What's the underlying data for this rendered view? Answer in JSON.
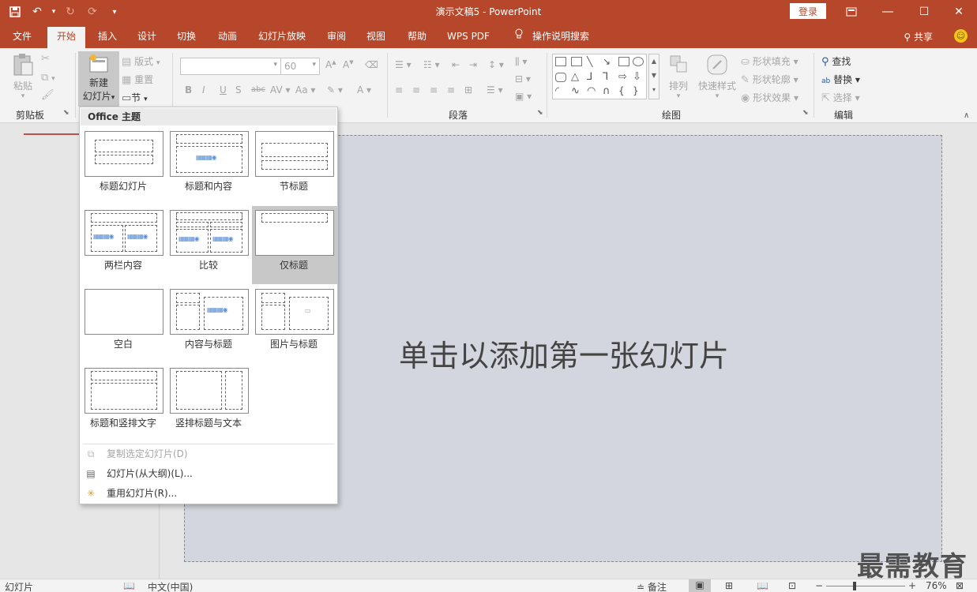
{
  "titlebar": {
    "title": "演示文稿5  -  PowerPoint",
    "login": "登录",
    "qat": [
      "save-icon",
      "undo-icon",
      "redo-icon",
      "repeat-icon",
      "customize-icon"
    ]
  },
  "tabs": [
    {
      "label": "文件"
    },
    {
      "label": "开始"
    },
    {
      "label": "插入"
    },
    {
      "label": "设计"
    },
    {
      "label": "切换"
    },
    {
      "label": "动画"
    },
    {
      "label": "幻灯片放映"
    },
    {
      "label": "审阅"
    },
    {
      "label": "视图"
    },
    {
      "label": "帮助"
    },
    {
      "label": "WPS PDF"
    },
    {
      "label": "操作说明搜索"
    }
  ],
  "share": "共享",
  "ribbon": {
    "clipboard": {
      "label": "剪贴板",
      "paste": "粘贴"
    },
    "slides": {
      "new_slide_line1": "新建",
      "new_slide_line2": "幻灯片",
      "layout": "版式",
      "reset": "重置",
      "section": "节"
    },
    "font": {
      "size": "60"
    },
    "paragraph": {
      "label": "段落"
    },
    "drawing": {
      "label": "绘图",
      "arrange": "排列",
      "quick_styles": "快速样式",
      "shape_fill": "形状填充",
      "shape_outline": "形状轮廓",
      "shape_effect": "形状效果"
    },
    "editing": {
      "label": "编辑",
      "find": "查找",
      "replace": "替换",
      "select": "选择"
    }
  },
  "dropdown": {
    "header": "Office 主题",
    "layouts": [
      {
        "label": "标题幻灯片"
      },
      {
        "label": "标题和内容"
      },
      {
        "label": "节标题"
      },
      {
        "label": "两栏内容"
      },
      {
        "label": "比较"
      },
      {
        "label": "仅标题"
      },
      {
        "label": "空白"
      },
      {
        "label": "内容与标题"
      },
      {
        "label": "图片与标题"
      },
      {
        "label": "标题和竖排文字"
      },
      {
        "label": "竖排标题与文本"
      }
    ],
    "commands": [
      {
        "label": "复制选定幻灯片(D)"
      },
      {
        "label": "幻灯片(从大纲)(L)..."
      },
      {
        "label": "重用幻灯片(R)..."
      }
    ]
  },
  "slide": {
    "hint": "单击以添加第一张幻灯片"
  },
  "statusbar": {
    "slides": "幻灯片",
    "language": "中文(中国)",
    "notes": "备注",
    "zoom": "76%"
  },
  "watermark": "最需教育"
}
